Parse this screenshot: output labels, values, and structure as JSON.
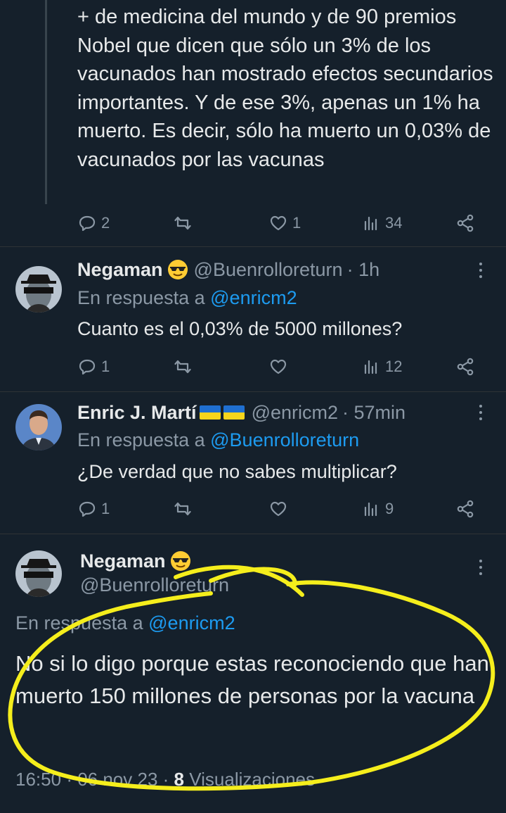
{
  "parent_post": {
    "text": "+ de medicina del mundo y de 90 premios Nobel que dicen que sólo un 3% de los vacunados han mostrado efectos secundarios importantes. Y de ese 3%, apenas un 1% ha muerto. Es decir, sólo ha muerto un 0,03% de vacunados por las vacunas",
    "replies": "2",
    "retweets": "",
    "likes": "1",
    "views": "34"
  },
  "reply1": {
    "name": "Negaman",
    "handle": "@Buenrolloreturn",
    "time": "· 1h",
    "in_reply_prefix": "En respuesta a",
    "in_reply_to": "@enricm2",
    "text": "Cuanto es el 0,03% de 5000 millones?",
    "replies": "1",
    "likes": "",
    "views": "12"
  },
  "reply2": {
    "name": "Enric J. Martí",
    "handle": "@enricm2",
    "time": "· 57min",
    "in_reply_prefix": "En respuesta a",
    "in_reply_to": "@Buenrolloreturn",
    "text": "¿De verdad que no sabes multiplicar?",
    "replies": "1",
    "likes": "",
    "views": "9"
  },
  "main_post": {
    "name": "Negaman",
    "handle": "@Buenrolloreturn",
    "in_reply_prefix": "En respuesta a",
    "in_reply_to": "@enricm2",
    "text": "No si lo digo porque estas reconociendo que han muerto 150 millones de personas por la vacuna",
    "time": "16:50",
    "date": "06 nov 23",
    "views_count": "8",
    "views_label": "Visualizaciones"
  },
  "colors": {
    "background": "#15202b",
    "text": "#e7e9ea",
    "muted": "#8b98a5",
    "link": "#1d9bf0",
    "highlight": "#f5ee1c"
  }
}
